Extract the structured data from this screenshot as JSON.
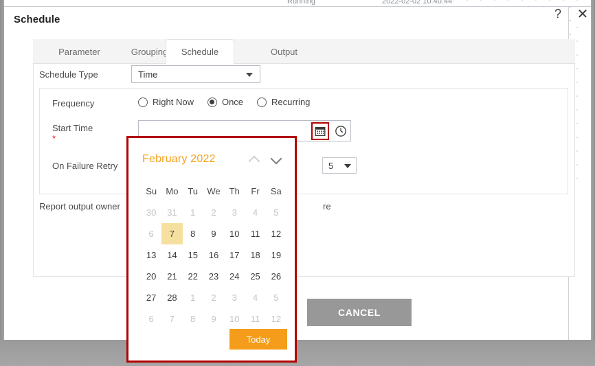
{
  "background": {
    "row_text_left": "Running",
    "row_text_right": "2022-02-02 10:40:44"
  },
  "dialog": {
    "title": "Schedule",
    "help_icon": "question-mark-icon",
    "close_icon": "close-x-icon"
  },
  "tabs": [
    {
      "label": "Parameter",
      "active": false
    },
    {
      "label": "Grouping",
      "active": false
    },
    {
      "label": "Schedule",
      "active": true
    },
    {
      "label": "Output",
      "active": false
    }
  ],
  "form": {
    "schedule_type_label": "Schedule Type",
    "schedule_type_value": "Time",
    "frequency_label": "Frequency",
    "frequency_options": [
      {
        "label": "Right Now",
        "selected": false
      },
      {
        "label": "Once",
        "selected": true
      },
      {
        "label": "Recurring",
        "selected": false
      }
    ],
    "start_time_label": "Start Time",
    "start_time_required_marker": "*",
    "start_time_value": "",
    "start_time_placeholder": "",
    "calendar_icon": "calendar-icon",
    "clock_icon": "clock-icon",
    "on_failure_retry_label": "On Failure Retry",
    "on_failure_retry_value": "5",
    "report_output_owner_label": "Report output owner",
    "obscured_text_fragment": "re"
  },
  "footer": {
    "cancel_label": "CANCEL"
  },
  "datepicker": {
    "month_title": "February 2022",
    "prev_icon": "chevron-up-icon",
    "next_icon": "chevron-down-icon",
    "weekday_headers": [
      "Su",
      "Mo",
      "Tu",
      "We",
      "Th",
      "Fr",
      "Sa"
    ],
    "today_label": "Today",
    "selected_day": 7,
    "weeks": [
      [
        {
          "d": "30",
          "muted": true,
          "selected": false
        },
        {
          "d": "31",
          "muted": true,
          "selected": false
        },
        {
          "d": "1",
          "muted": true,
          "selected": false
        },
        {
          "d": "2",
          "muted": true,
          "selected": false
        },
        {
          "d": "3",
          "muted": true,
          "selected": false
        },
        {
          "d": "4",
          "muted": true,
          "selected": false
        },
        {
          "d": "5",
          "muted": true,
          "selected": false
        }
      ],
      [
        {
          "d": "6",
          "muted": true,
          "selected": false
        },
        {
          "d": "7",
          "muted": false,
          "selected": true
        },
        {
          "d": "8",
          "muted": false,
          "selected": false
        },
        {
          "d": "9",
          "muted": false,
          "selected": false
        },
        {
          "d": "10",
          "muted": false,
          "selected": false
        },
        {
          "d": "11",
          "muted": false,
          "selected": false
        },
        {
          "d": "12",
          "muted": false,
          "selected": false
        }
      ],
      [
        {
          "d": "13",
          "muted": false,
          "selected": false
        },
        {
          "d": "14",
          "muted": false,
          "selected": false
        },
        {
          "d": "15",
          "muted": false,
          "selected": false
        },
        {
          "d": "16",
          "muted": false,
          "selected": false
        },
        {
          "d": "17",
          "muted": false,
          "selected": false
        },
        {
          "d": "18",
          "muted": false,
          "selected": false
        },
        {
          "d": "19",
          "muted": false,
          "selected": false
        }
      ],
      [
        {
          "d": "20",
          "muted": false,
          "selected": false
        },
        {
          "d": "21",
          "muted": false,
          "selected": false
        },
        {
          "d": "22",
          "muted": false,
          "selected": false
        },
        {
          "d": "23",
          "muted": false,
          "selected": false
        },
        {
          "d": "24",
          "muted": false,
          "selected": false
        },
        {
          "d": "25",
          "muted": false,
          "selected": false
        },
        {
          "d": "26",
          "muted": false,
          "selected": false
        }
      ],
      [
        {
          "d": "27",
          "muted": false,
          "selected": false
        },
        {
          "d": "28",
          "muted": false,
          "selected": false
        },
        {
          "d": "1",
          "muted": true,
          "selected": false
        },
        {
          "d": "2",
          "muted": true,
          "selected": false
        },
        {
          "d": "3",
          "muted": true,
          "selected": false
        },
        {
          "d": "4",
          "muted": true,
          "selected": false
        },
        {
          "d": "5",
          "muted": true,
          "selected": false
        }
      ],
      [
        {
          "d": "6",
          "muted": true,
          "selected": false
        },
        {
          "d": "7",
          "muted": true,
          "selected": false
        },
        {
          "d": "8",
          "muted": true,
          "selected": false
        },
        {
          "d": "9",
          "muted": true,
          "selected": false
        },
        {
          "d": "10",
          "muted": true,
          "selected": false
        },
        {
          "d": "11",
          "muted": true,
          "selected": false
        },
        {
          "d": "12",
          "muted": true,
          "selected": false
        }
      ]
    ]
  },
  "colors": {
    "accent_orange": "#f59c1a",
    "month_title": "#f5a21d",
    "highlight_red": "#b30000",
    "selected_day_bg": "#f5e0a0",
    "cancel_grey": "#989898",
    "required_red": "#e02020"
  }
}
